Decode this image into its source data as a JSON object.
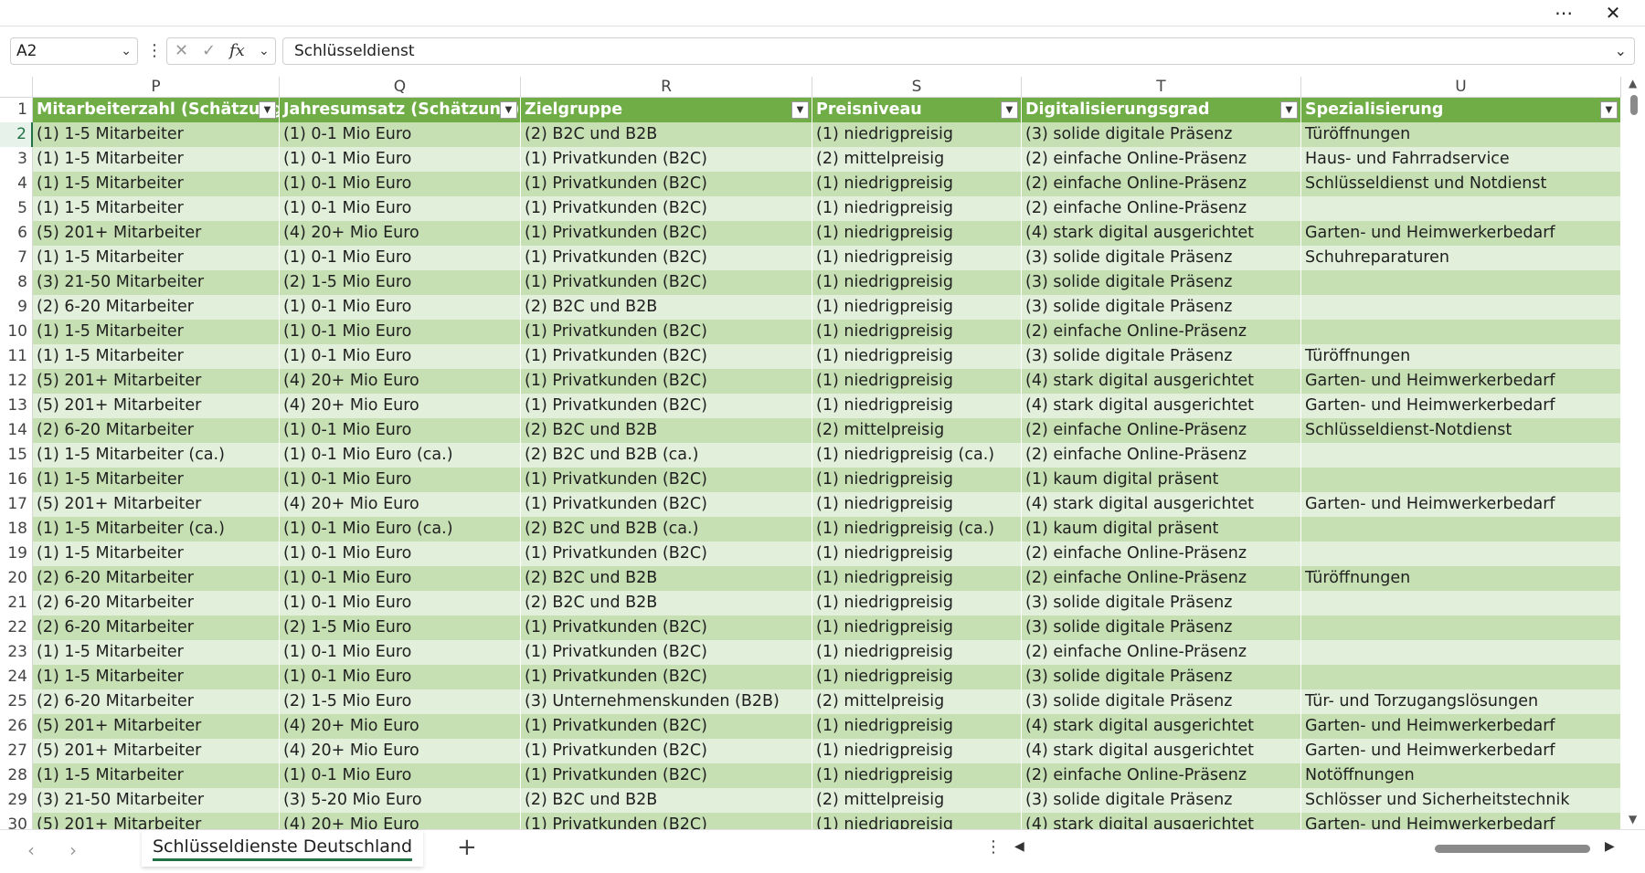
{
  "title_bar": {
    "more_icon": "more-horizontal-icon",
    "close_icon": "close-icon"
  },
  "formula_bar": {
    "name_box": "A2",
    "formula": "Schlüsseldienst",
    "fx_label": "fx"
  },
  "columns": [
    "P",
    "Q",
    "R",
    "S",
    "T",
    "U"
  ],
  "headers": [
    "Mitarbeiterzahl (Schätzung)",
    "Jahresumsatz (Schätzung)",
    "Zielgruppe",
    "Preisniveau",
    "Digitalisierungsgrad",
    "Spezialisierung"
  ],
  "rows": [
    {
      "n": "2",
      "c": [
        "(1) 1-5 Mitarbeiter",
        "(1) 0-1 Mio Euro",
        "(2) B2C und B2B",
        "(1) niedrigpreisig",
        "(3) solide digitale Präsenz",
        "Türöffnungen"
      ]
    },
    {
      "n": "3",
      "c": [
        "(1) 1-5 Mitarbeiter",
        "(1) 0-1 Mio Euro",
        "(1) Privatkunden (B2C)",
        "(2) mittelpreisig",
        "(2) einfache Online-Präsenz",
        "Haus- und Fahrradservice"
      ]
    },
    {
      "n": "4",
      "c": [
        "(1) 1-5 Mitarbeiter",
        "(1) 0-1 Mio Euro",
        "(1) Privatkunden (B2C)",
        "(1) niedrigpreisig",
        "(2) einfache Online-Präsenz",
        "Schlüsseldienst und Notdienst"
      ]
    },
    {
      "n": "5",
      "c": [
        "(1) 1-5 Mitarbeiter",
        "(1) 0-1 Mio Euro",
        "(1) Privatkunden (B2C)",
        "(1) niedrigpreisig",
        "(2) einfache Online-Präsenz",
        ""
      ]
    },
    {
      "n": "6",
      "c": [
        "(5) 201+ Mitarbeiter",
        "(4) 20+ Mio Euro",
        "(1) Privatkunden (B2C)",
        "(1) niedrigpreisig",
        "(4) stark digital ausgerichtet",
        "Garten- und Heimwerkerbedarf"
      ]
    },
    {
      "n": "7",
      "c": [
        "(1) 1-5 Mitarbeiter",
        "(1) 0-1 Mio Euro",
        "(1) Privatkunden (B2C)",
        "(1) niedrigpreisig",
        "(3) solide digitale Präsenz",
        "Schuhreparaturen"
      ]
    },
    {
      "n": "8",
      "c": [
        "(3) 21-50 Mitarbeiter",
        "(2) 1-5 Mio Euro",
        "(1) Privatkunden (B2C)",
        "(1) niedrigpreisig",
        "(3) solide digitale Präsenz",
        ""
      ]
    },
    {
      "n": "9",
      "c": [
        "(2) 6-20 Mitarbeiter",
        "(1) 0-1 Mio Euro",
        "(2) B2C und B2B",
        "(1) niedrigpreisig",
        "(3) solide digitale Präsenz",
        ""
      ]
    },
    {
      "n": "10",
      "c": [
        "(1) 1-5 Mitarbeiter",
        "(1) 0-1 Mio Euro",
        "(1) Privatkunden (B2C)",
        "(1) niedrigpreisig",
        "(2) einfache Online-Präsenz",
        ""
      ]
    },
    {
      "n": "11",
      "c": [
        "(1) 1-5 Mitarbeiter",
        "(1) 0-1 Mio Euro",
        "(1) Privatkunden (B2C)",
        "(1) niedrigpreisig",
        "(3) solide digitale Präsenz",
        "Türöffnungen"
      ]
    },
    {
      "n": "12",
      "c": [
        "(5) 201+ Mitarbeiter",
        "(4) 20+ Mio Euro",
        "(1) Privatkunden (B2C)",
        "(1) niedrigpreisig",
        "(4) stark digital ausgerichtet",
        "Garten- und Heimwerkerbedarf"
      ]
    },
    {
      "n": "13",
      "c": [
        "(5) 201+ Mitarbeiter",
        "(4) 20+ Mio Euro",
        "(1) Privatkunden (B2C)",
        "(1) niedrigpreisig",
        "(4) stark digital ausgerichtet",
        "Garten- und Heimwerkerbedarf"
      ]
    },
    {
      "n": "14",
      "c": [
        "(2) 6-20 Mitarbeiter",
        "(1) 0-1 Mio Euro",
        "(2) B2C und B2B",
        "(2) mittelpreisig",
        "(2) einfache Online-Präsenz",
        "Schlüsseldienst-Notdienst"
      ]
    },
    {
      "n": "15",
      "c": [
        "(1) 1-5 Mitarbeiter (ca.)",
        "(1) 0-1 Mio Euro (ca.)",
        "(2) B2C und B2B (ca.)",
        "(1) niedrigpreisig (ca.)",
        "(2) einfache Online-Präsenz",
        ""
      ]
    },
    {
      "n": "16",
      "c": [
        "(1) 1-5 Mitarbeiter",
        "(1) 0-1 Mio Euro",
        "(1) Privatkunden (B2C)",
        "(1) niedrigpreisig",
        "(1) kaum digital präsent",
        ""
      ]
    },
    {
      "n": "17",
      "c": [
        "(5) 201+ Mitarbeiter",
        "(4) 20+ Mio Euro",
        "(1) Privatkunden (B2C)",
        "(1) niedrigpreisig",
        "(4) stark digital ausgerichtet",
        "Garten- und Heimwerkerbedarf"
      ]
    },
    {
      "n": "18",
      "c": [
        "(1) 1-5 Mitarbeiter (ca.)",
        "(1) 0-1 Mio Euro (ca.)",
        "(2) B2C und B2B (ca.)",
        "(1) niedrigpreisig (ca.)",
        "(1) kaum digital präsent",
        ""
      ]
    },
    {
      "n": "19",
      "c": [
        "(1) 1-5 Mitarbeiter",
        "(1) 0-1 Mio Euro",
        "(1) Privatkunden (B2C)",
        "(1) niedrigpreisig",
        "(2) einfache Online-Präsenz",
        ""
      ]
    },
    {
      "n": "20",
      "c": [
        "(2) 6-20 Mitarbeiter",
        "(1) 0-1 Mio Euro",
        "(2) B2C und B2B",
        "(1) niedrigpreisig",
        "(2) einfache Online-Präsenz",
        "Türöffnungen"
      ]
    },
    {
      "n": "21",
      "c": [
        "(2) 6-20 Mitarbeiter",
        "(1) 0-1 Mio Euro",
        "(2) B2C und B2B",
        "(1) niedrigpreisig",
        "(3) solide digitale Präsenz",
        ""
      ]
    },
    {
      "n": "22",
      "c": [
        "(2) 6-20 Mitarbeiter",
        "(2) 1-5 Mio Euro",
        "(1) Privatkunden (B2C)",
        "(1) niedrigpreisig",
        "(3) solide digitale Präsenz",
        ""
      ]
    },
    {
      "n": "23",
      "c": [
        "(1) 1-5 Mitarbeiter",
        "(1) 0-1 Mio Euro",
        "(1) Privatkunden (B2C)",
        "(1) niedrigpreisig",
        "(2) einfache Online-Präsenz",
        ""
      ]
    },
    {
      "n": "24",
      "c": [
        "(1) 1-5 Mitarbeiter",
        "(1) 0-1 Mio Euro",
        "(1) Privatkunden (B2C)",
        "(1) niedrigpreisig",
        "(3) solide digitale Präsenz",
        ""
      ]
    },
    {
      "n": "25",
      "c": [
        "(2) 6-20 Mitarbeiter",
        "(2) 1-5 Mio Euro",
        "(3) Unternehmenskunden (B2B)",
        "(2) mittelpreisig",
        "(3) solide digitale Präsenz",
        "Tür- und Torzugangslösungen"
      ]
    },
    {
      "n": "26",
      "c": [
        "(5) 201+ Mitarbeiter",
        "(4) 20+ Mio Euro",
        "(1) Privatkunden (B2C)",
        "(1) niedrigpreisig",
        "(4) stark digital ausgerichtet",
        "Garten- und Heimwerkerbedarf"
      ]
    },
    {
      "n": "27",
      "c": [
        "(5) 201+ Mitarbeiter",
        "(4) 20+ Mio Euro",
        "(1) Privatkunden (B2C)",
        "(1) niedrigpreisig",
        "(4) stark digital ausgerichtet",
        "Garten- und Heimwerkerbedarf"
      ]
    },
    {
      "n": "28",
      "c": [
        "(1) 1-5 Mitarbeiter",
        "(1) 0-1 Mio Euro",
        "(1) Privatkunden (B2C)",
        "(1) niedrigpreisig",
        "(2) einfache Online-Präsenz",
        "Notöffnungen"
      ]
    },
    {
      "n": "29",
      "c": [
        "(3) 21-50 Mitarbeiter",
        "(3) 5-20 Mio Euro",
        "(2) B2C und B2B",
        "(2) mittelpreisig",
        "(3) solide digitale Präsenz",
        "Schlösser und Sicherheitstechnik"
      ]
    },
    {
      "n": "30",
      "c": [
        "(5) 201+ Mitarbeiter",
        "(4) 20+ Mio Euro",
        "(1) Privatkunden (B2C)",
        "(1) niedrigpreisig",
        "(4) stark digital ausgerichtet",
        "Garten- und Heimwerkerbedarf"
      ]
    }
  ],
  "sheet_tab": {
    "label": "Schlüsseldienste Deutschland"
  },
  "colors": {
    "header_bg": "#70ad47",
    "band_dark": "#c6e0b4",
    "band_light": "#e2efda",
    "accent": "#217346"
  }
}
